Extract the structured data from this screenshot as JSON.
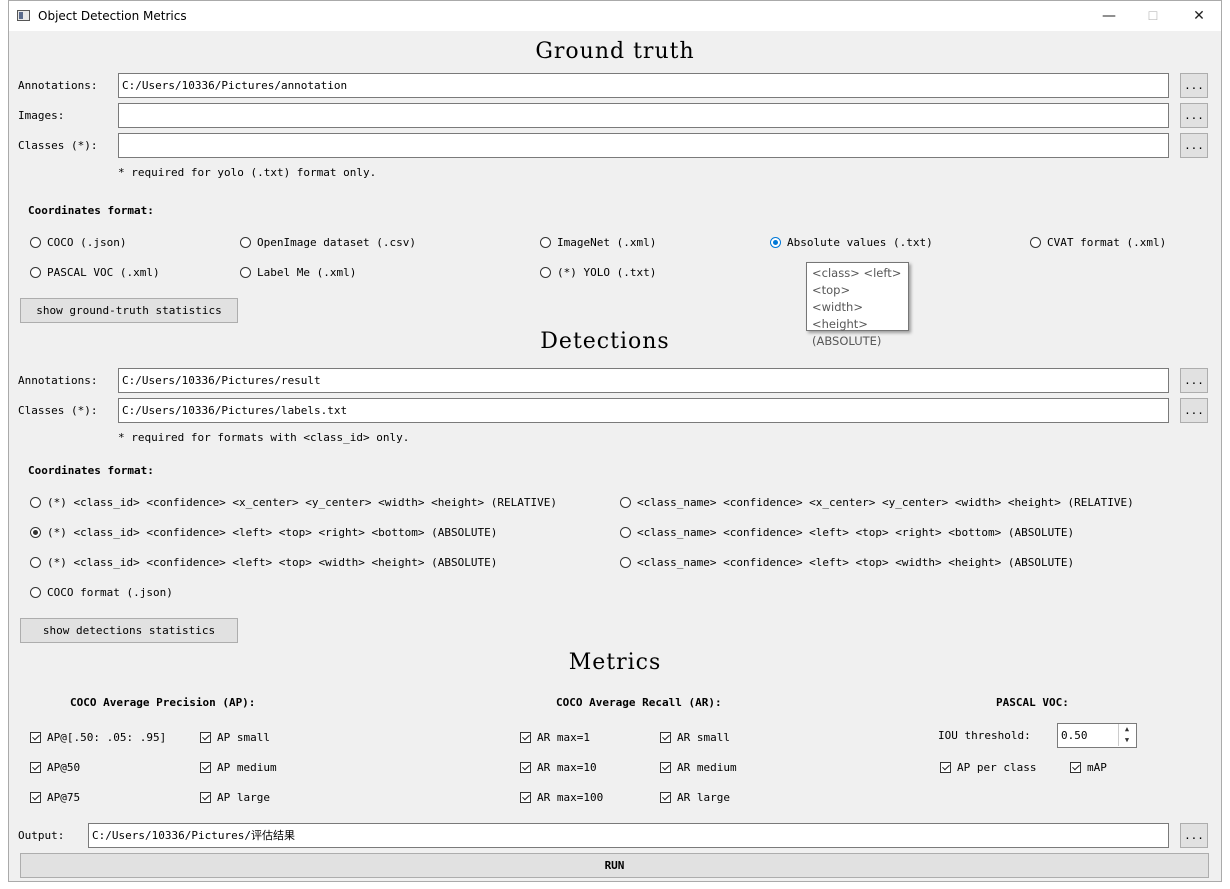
{
  "window": {
    "title": "Object Detection Metrics",
    "minimize": "—",
    "maximize": "☐",
    "close": "✕"
  },
  "ground_truth": {
    "heading": "Ground truth",
    "annotations_label": "Annotations:",
    "annotations_value": "C:/Users/10336/Pictures/annotation",
    "images_label": "Images:",
    "images_value": "",
    "classes_label": "Classes (*):",
    "classes_value": "",
    "browse": "...",
    "note": "* required for yolo (.txt) format only.",
    "format_label": "Coordinates format:",
    "formats": [
      "COCO (.json)",
      "OpenImage dataset (.csv)",
      "ImageNet (.xml)",
      "Absolute values (.txt)",
      "CVAT format (.xml)",
      "PASCAL VOC (.xml)",
      "Label Me (.xml)",
      "(*) YOLO (.txt)"
    ],
    "selected_format": "Absolute values (.txt)",
    "stats_button": "show ground-truth statistics",
    "tooltip_lines": [
      "<class> <left>",
      "<top> <width>",
      "<height>",
      "(ABSOLUTE)"
    ]
  },
  "detections": {
    "heading": "Detections",
    "annotations_label": "Annotations:",
    "annotations_value": "C:/Users/10336/Pictures/result",
    "classes_label": "Classes (*):",
    "classes_value": "C:/Users/10336/Pictures/labels.txt",
    "browse": "...",
    "note": "* required for formats with <class_id> only.",
    "format_label": "Coordinates format:",
    "formats": [
      "(*) <class_id> <confidence> <x_center> <y_center> <width> <height> (RELATIVE)",
      "<class_name> <confidence> <x_center> <y_center> <width> <height> (RELATIVE)",
      "(*) <class_id> <confidence> <left> <top> <right> <bottom> (ABSOLUTE)",
      "<class_name> <confidence> <left> <top> <right> <bottom> (ABSOLUTE)",
      "(*) <class_id> <confidence> <left> <top> <width> <height> (ABSOLUTE)",
      "<class_name> <confidence> <left> <top> <width> <height> (ABSOLUTE)",
      "COCO format (.json)"
    ],
    "selected_format": "(*) <class_id> <confidence> <left> <top> <right> <bottom> (ABSOLUTE)",
    "stats_button": "show detections statistics"
  },
  "metrics": {
    "heading": "Metrics",
    "coco_ap_title": "COCO Average Precision (AP):",
    "coco_ap": [
      "AP@[.50: .05: .95]",
      "AP small",
      "AP@50",
      "AP medium",
      "AP@75",
      "AP large"
    ],
    "coco_ar_title": "COCO Average Recall (AR):",
    "coco_ar": [
      "AR max=1",
      "AR small",
      "AR max=10",
      "AR medium",
      "AR max=100",
      "AR large"
    ],
    "voc_title": "PASCAL VOC:",
    "iou_label": "IOU threshold:",
    "iou_value": "0.50",
    "voc_checks": [
      "AP per class",
      "mAP"
    ]
  },
  "output": {
    "label": "Output:",
    "value": "C:/Users/10336/Pictures/评估结果",
    "browse": "..."
  },
  "run_button": "RUN"
}
